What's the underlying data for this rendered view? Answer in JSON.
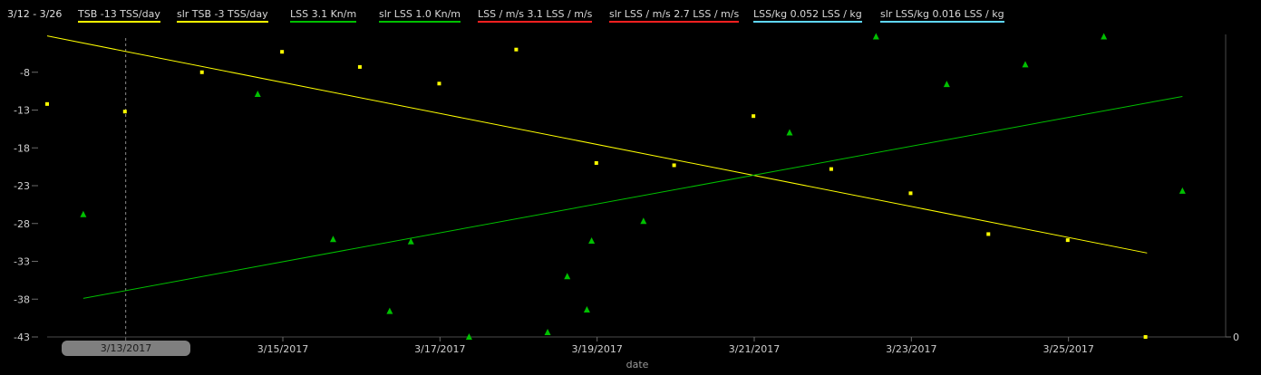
{
  "header": {
    "range": "3/12 - 3/26"
  },
  "legend": [
    {
      "label": "TSB  -13 TSS/day",
      "color": "#ffff00"
    },
    {
      "label": "slr TSB  -3 TSS/day",
      "color": "#ffff00"
    },
    {
      "label": "LSS  3.1 Kn/m",
      "color": "#00c000"
    },
    {
      "label": "slr LSS  1.0 Kn/m",
      "color": "#00c000"
    },
    {
      "label": "LSS / m/s  3.1 LSS / m/s",
      "color": "#ff2020"
    },
    {
      "label": "slr LSS / m/s  2.7 LSS / m/s",
      "color": "#ff2020"
    },
    {
      "label": "LSS/kg  0.052 LSS / kg",
      "color": "#5fd7ff"
    },
    {
      "label": "slr LSS/kg  0.016 LSS / kg",
      "color": "#5fd7ff"
    }
  ],
  "cursor": {
    "date": "3/13/2017"
  },
  "colors": {
    "background": "#000000",
    "tsb": "#ffff00",
    "lss": "#00c000",
    "axis": "#4a4a4a"
  },
  "chart_data": {
    "type": "scatter",
    "xlabel": "date",
    "x_ticks": [
      "3/13/2017",
      "3/15/2017",
      "3/17/2017",
      "3/19/2017",
      "3/21/2017",
      "3/23/2017",
      "3/25/2017"
    ],
    "xlim": [
      "2017-03-12",
      "2017-03-27"
    ],
    "y_ticks": [
      -8,
      -13,
      -18,
      -23,
      -28,
      -33,
      -38,
      -43
    ],
    "ylim": [
      -43,
      -3
    ],
    "y2_ticks": [
      0
    ],
    "series": [
      {
        "name": "TSB",
        "marker": "square",
        "color": "#ffff00",
        "points": [
          [
            "2017-03-12",
            -12.2
          ],
          [
            "2017-03-12.99",
            -13.2
          ],
          [
            "2017-03-13.97",
            -8
          ],
          [
            "2017-03-14.99",
            -5.3
          ],
          [
            "2017-03-15.98",
            -7.3
          ],
          [
            "2017-03-16.99",
            -9.5
          ],
          [
            "2017-03-17.97",
            -5
          ],
          [
            "2017-03-18.99",
            -20
          ],
          [
            "2017-03-19.98",
            -20.3
          ],
          [
            "2017-03-20.99",
            -13.8
          ],
          [
            "2017-03-21.98",
            -20.8
          ],
          [
            "2017-03-22.99",
            -24
          ],
          [
            "2017-03-23.98",
            -29.4
          ],
          [
            "2017-03-24.99",
            -30.2
          ],
          [
            "2017-03-25.98",
            -43
          ]
        ]
      },
      {
        "name": "LSS",
        "marker": "triangle",
        "color": "#00c000",
        "points": [
          [
            "2017-03-12.46",
            -26.8
          ],
          [
            "2017-03-14.68",
            -10.9
          ],
          [
            "2017-03-15.64",
            -30.1
          ],
          [
            "2017-03-16.36",
            -39.6
          ],
          [
            "2017-03-16.63",
            -30.4
          ],
          [
            "2017-03-17.37",
            -43
          ],
          [
            "2017-03-18.37",
            -42.4
          ],
          [
            "2017-03-18.62",
            -35
          ],
          [
            "2017-03-18.87",
            -39.4
          ],
          [
            "2017-03-18.93",
            -30.3
          ],
          [
            "2017-03-19.59",
            -27.7
          ],
          [
            "2017-03-21.45",
            -16
          ],
          [
            "2017-03-22.55",
            -3.3
          ],
          [
            "2017-03-23.45",
            -9.6
          ],
          [
            "2017-03-24.45",
            -7
          ],
          [
            "2017-03-25.45",
            -3.3
          ],
          [
            "2017-03-26.45",
            -23.7
          ]
        ]
      }
    ],
    "trendlines": [
      {
        "name": "slr TSB",
        "color": "#ffff00",
        "from": [
          "2017-03-12",
          -3.2
        ],
        "to": [
          "2017-03-26",
          -31.9
        ]
      },
      {
        "name": "slr LSS",
        "color": "#00c000",
        "from": [
          "2017-03-12.46",
          -37.9
        ],
        "to": [
          "2017-03-26.45",
          -11.2
        ]
      }
    ],
    "cursor_date": "2017-03-13"
  }
}
